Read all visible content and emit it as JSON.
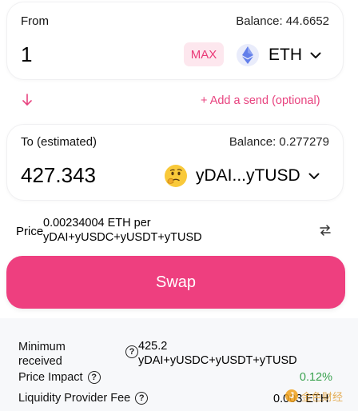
{
  "from": {
    "label": "From",
    "balance": "Balance: 44.6652",
    "amount": "1",
    "max_label": "MAX",
    "token_symbol": "ETH",
    "token_icon": "ethereum-icon"
  },
  "actions": {
    "add_send": "+ Add a send (optional)"
  },
  "to": {
    "label": "To (estimated)",
    "balance": "Balance: 0.277279",
    "amount": "427.343",
    "token_symbol": "yDAI...yTUSD",
    "token_icon": "thinking-face-emoji-icon"
  },
  "price": {
    "label": "Price",
    "value_line1": "0.00234004 ETH per",
    "value_line2": "yDAI+yUSDC+yUSDT+yTUSD"
  },
  "swap_button": {
    "label": "Swap"
  },
  "details": {
    "minimum_label_line1": "Minimum",
    "minimum_label_line2": "received",
    "minimum_value_line1": "425.2",
    "minimum_value_line2": "yDAI+yUSDC+yUSDT+yTUSD",
    "impact_label": "Price Impact",
    "impact_value": "0.12%",
    "fee_label": "Liquidity Provider Fee",
    "fee_value": "0.003 ETH"
  },
  "watermark": {
    "text": "金色财经"
  },
  "colors": {
    "accent": "#ee3f7f",
    "accent_text": "#e8437f",
    "max_bg": "#fde7ee",
    "positive": "#3aa24f",
    "details_bg": "#f7f8fa"
  }
}
